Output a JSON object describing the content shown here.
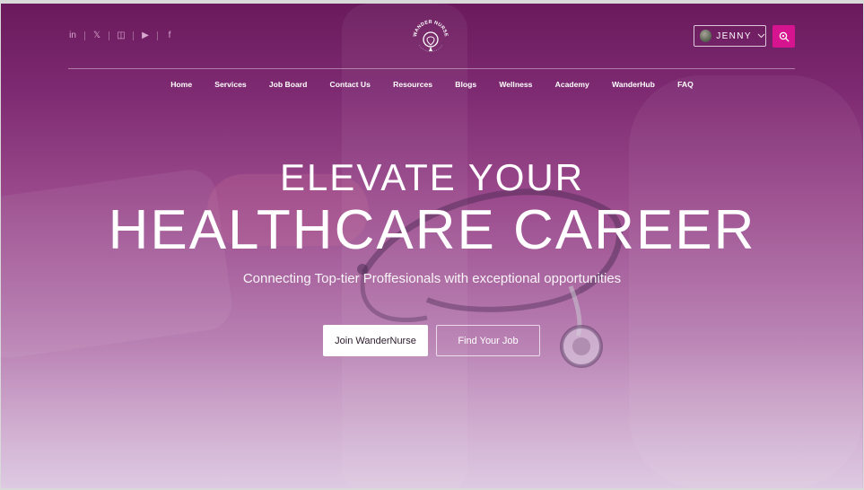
{
  "header": {
    "brand": "WANDER NURSE",
    "social_icons": [
      "linkedin-icon",
      "x-twitter-icon",
      "instagram-icon",
      "youtube-icon",
      "facebook-icon"
    ],
    "social_glyphs": [
      "in",
      "𝕏",
      "◫",
      "▶",
      "f"
    ],
    "user": {
      "name": "JENNY"
    },
    "colors": {
      "accent": "#d6148f"
    }
  },
  "nav": {
    "items": [
      "Home",
      "Services",
      "Job Board",
      "Contact Us",
      "Resources",
      "Blogs",
      "Wellness",
      "Academy",
      "WanderHub",
      "FAQ"
    ]
  },
  "hero": {
    "line1": "ELEVATE YOUR",
    "line2": "HEALTHCARE CAREER",
    "subtitle": "Connecting Top-tier Proffesionals with exceptional opportunities",
    "primary_cta": "Join WanderNurse",
    "secondary_cta": "Find Your Job"
  }
}
